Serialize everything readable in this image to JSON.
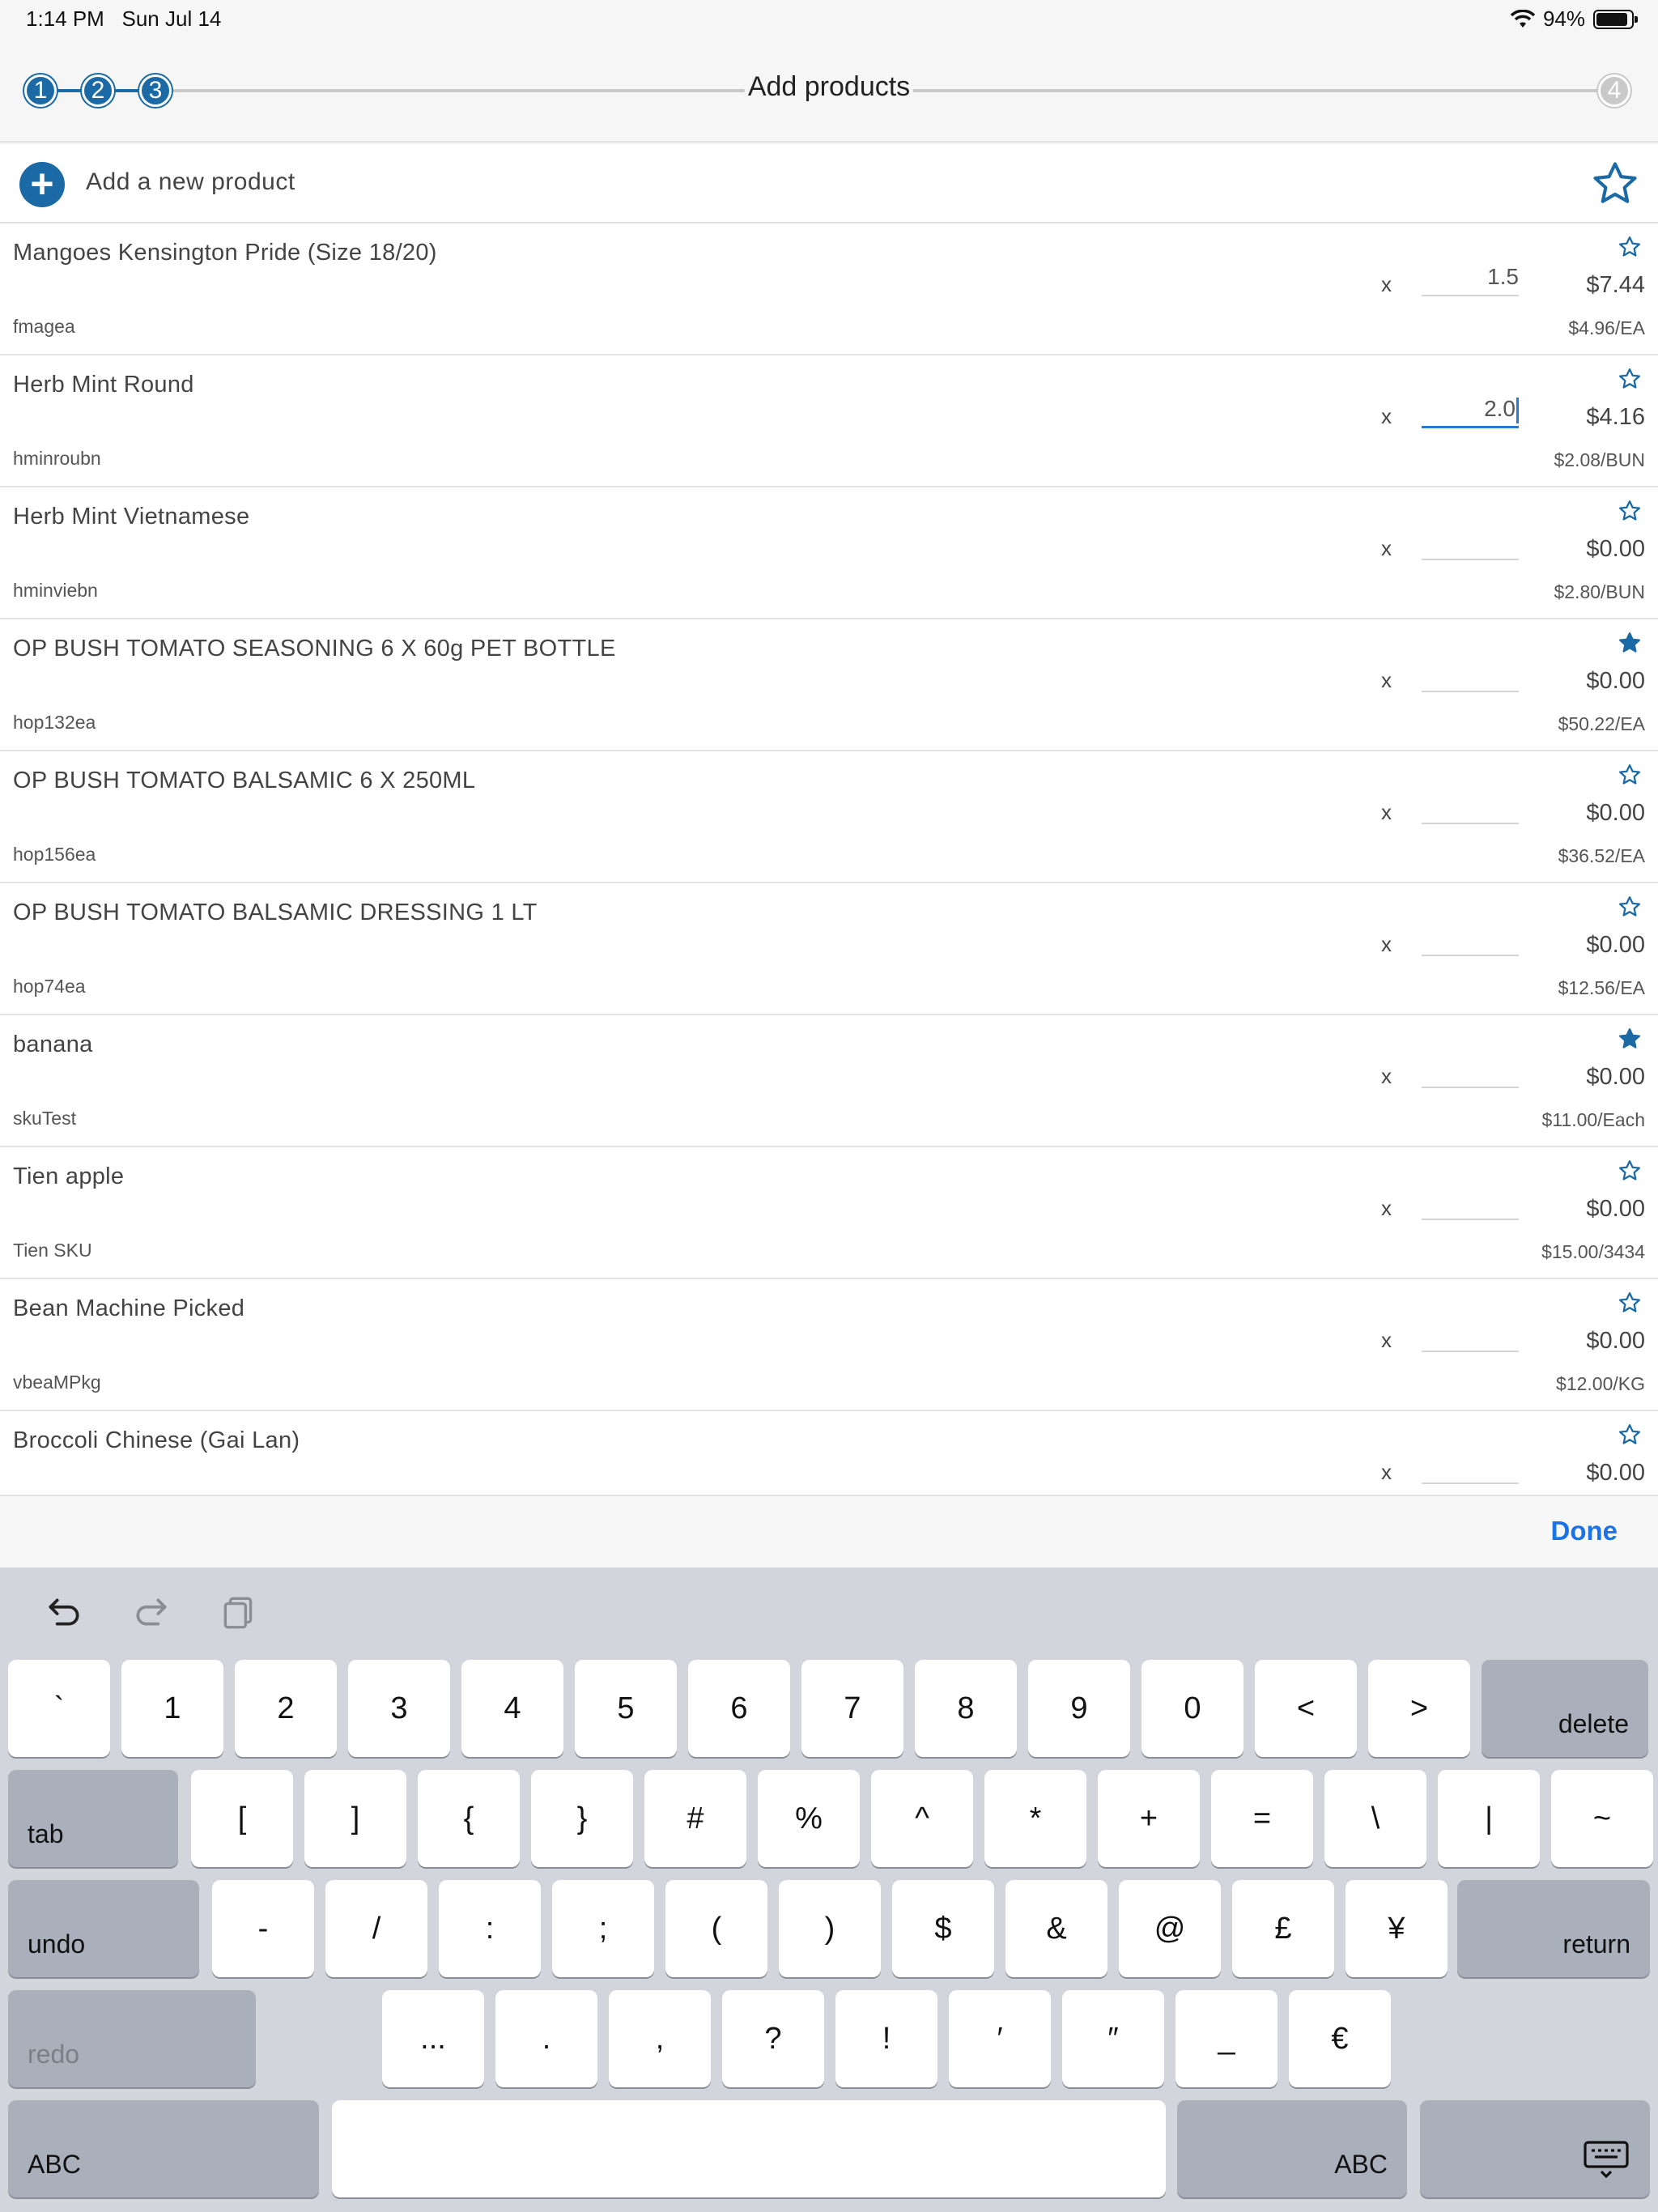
{
  "status_bar": {
    "time": "1:14 PM",
    "date": "Sun Jul 14",
    "battery": "94%"
  },
  "stepper": {
    "title": "Add products",
    "steps": [
      "1",
      "2",
      "3",
      "4"
    ],
    "current_step": 3
  },
  "add_product": {
    "label": "Add a new product"
  },
  "products": [
    {
      "name": "Mangoes Kensington Pride (Size 18/20)",
      "sku": "fmagea",
      "qty": "1.5",
      "total": "$7.44",
      "unit_price": "$4.96/EA",
      "favorite": false
    },
    {
      "name": "Herb Mint Round",
      "sku": "hminroubn",
      "qty": "2.0",
      "total": "$4.16",
      "unit_price": "$2.08/BUN",
      "favorite": false
    },
    {
      "name": "Herb Mint Vietnamese",
      "sku": "hminviebn",
      "qty": "",
      "total": "$0.00",
      "unit_price": "$2.80/BUN",
      "favorite": false
    },
    {
      "name": "OP BUSH TOMATO SEASONING 6 X 60g PET BOTTLE",
      "sku": "hop132ea",
      "qty": "",
      "total": "$0.00",
      "unit_price": "$50.22/EA",
      "favorite": true
    },
    {
      "name": "OP BUSH TOMATO BALSAMIC 6 X 250ML",
      "sku": "hop156ea",
      "qty": "",
      "total": "$0.00",
      "unit_price": "$36.52/EA",
      "favorite": false
    },
    {
      "name": "OP BUSH TOMATO BALSAMIC DRESSING 1 LT",
      "sku": "hop74ea",
      "qty": "",
      "total": "$0.00",
      "unit_price": "$12.56/EA",
      "favorite": false
    },
    {
      "name": "banana",
      "sku": "skuTest",
      "qty": "",
      "total": "$0.00",
      "unit_price": "$11.00/Each",
      "favorite": true
    },
    {
      "name": "Tien apple",
      "sku": "Tien SKU",
      "qty": "",
      "total": "$0.00",
      "unit_price": "$15.00/3434",
      "favorite": false
    },
    {
      "name": "Bean Machine Picked",
      "sku": "vbeaMPkg",
      "qty": "",
      "total": "$0.00",
      "unit_price": "$12.00/KG",
      "favorite": false
    },
    {
      "name": "Broccoli Chinese (Gai Lan)",
      "sku": "",
      "qty": "",
      "total": "$0.00",
      "unit_price": "",
      "favorite": false
    }
  ],
  "times_symbol": "x",
  "accessory": {
    "done_label": "Done"
  },
  "keyboard": {
    "tools": [
      "undo-icon",
      "redo-icon",
      "paste-icon"
    ],
    "row1": [
      "`",
      "1",
      "2",
      "3",
      "4",
      "5",
      "6",
      "7",
      "8",
      "9",
      "0",
      "<",
      ">"
    ],
    "row1_end": "delete",
    "row2_start": "tab",
    "row2": [
      "[",
      "]",
      "{",
      "}",
      "#",
      "%",
      "^",
      "*",
      "+",
      "=",
      "\\",
      "|",
      "~"
    ],
    "row3_start": "undo",
    "row3": [
      "-",
      "/",
      ":",
      ";",
      "(",
      ")",
      "$",
      "&",
      "@",
      "£",
      "¥"
    ],
    "row3_end": "return",
    "row4_start": "redo",
    "row4": [
      "...",
      ".",
      ",",
      "?",
      "!",
      "′",
      "″",
      "_",
      "€"
    ],
    "row5_left": "ABC",
    "row5_right": "ABC",
    "dismiss_icon": "keyboard-dismiss-icon"
  },
  "colors": {
    "accent": "#1b6aa5",
    "done": "#1a73e8",
    "keyboard_bg": "#d2d5db"
  }
}
